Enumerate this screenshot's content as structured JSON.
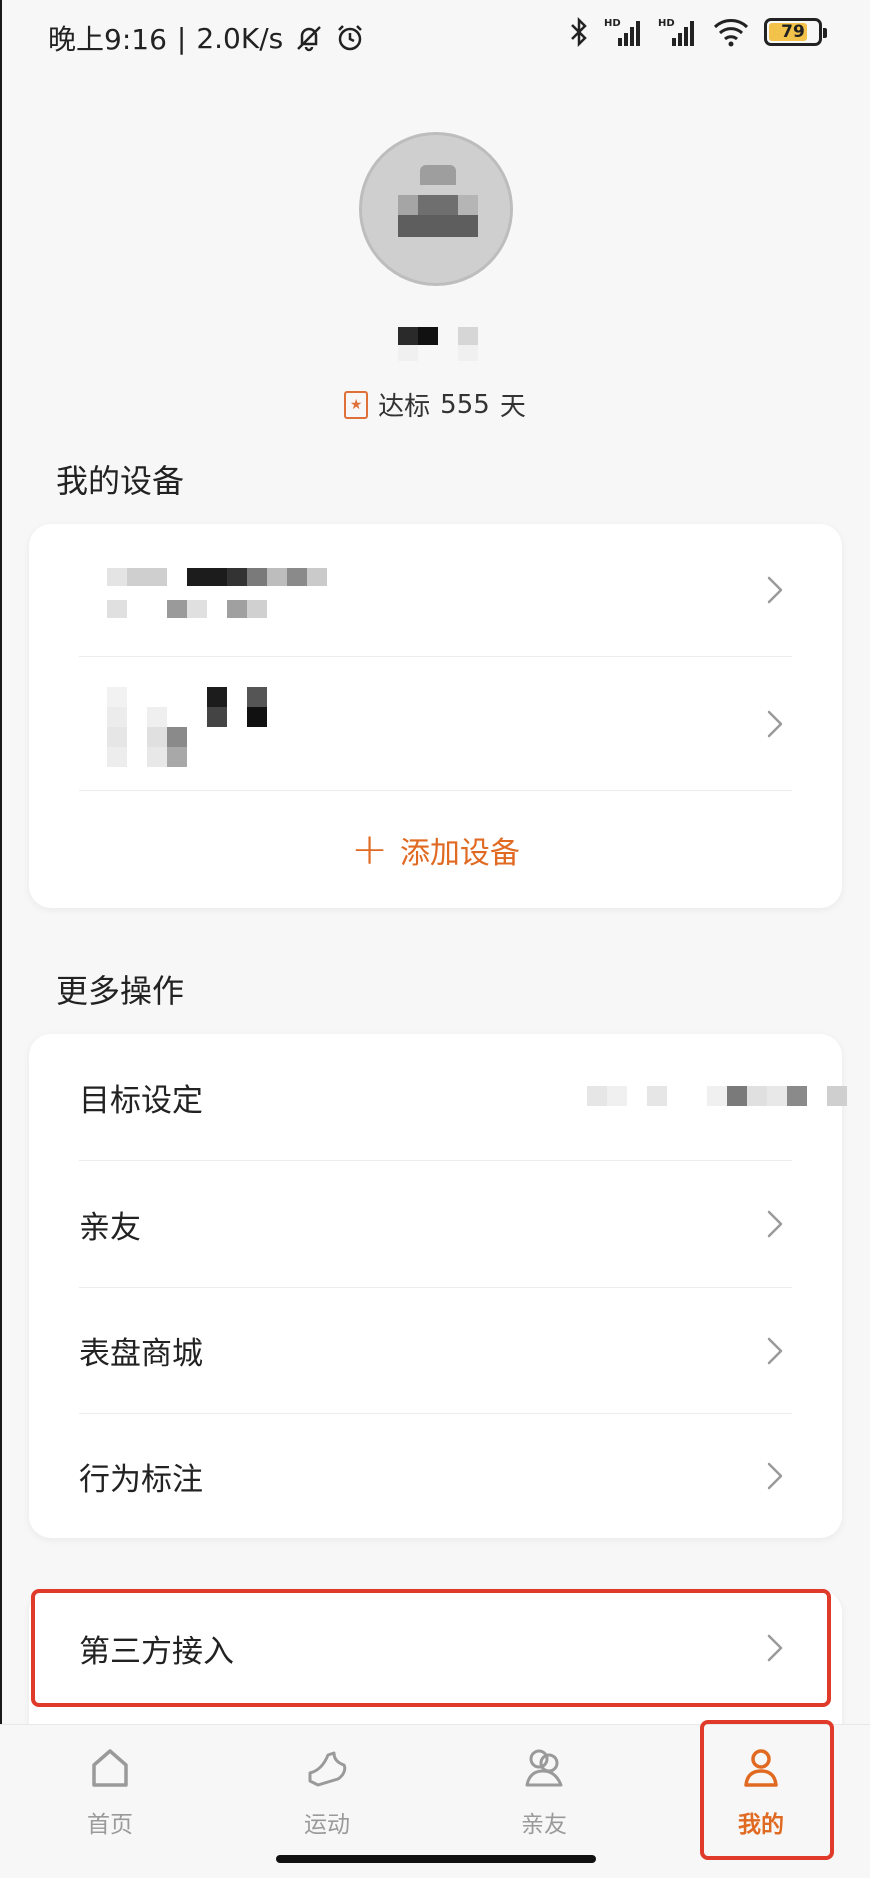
{
  "status_bar": {
    "time": "晚上9:16",
    "separator": "|",
    "net_speed": "2.0K/s",
    "battery_level": "79",
    "battery_fraction": 0.79,
    "signal_label_1": "HD",
    "signal_label_2": "HD"
  },
  "profile": {
    "streak_label": "达标",
    "streak_days": "555",
    "streak_unit": "天"
  },
  "devices_section": {
    "title": "我的设备",
    "add_device_label": "添加设备"
  },
  "more_section": {
    "title": "更多操作",
    "items": [
      {
        "label": "目标设定"
      },
      {
        "label": "亲友"
      },
      {
        "label": "表盘商城"
      },
      {
        "label": "行为标注"
      }
    ]
  },
  "third_party": {
    "label": "第三方接入"
  },
  "bottom_nav": {
    "items": [
      {
        "label": "首页",
        "icon": "home-icon",
        "active": false
      },
      {
        "label": "运动",
        "icon": "shoe-icon",
        "active": false
      },
      {
        "label": "亲友",
        "icon": "friends-icon",
        "active": false
      },
      {
        "label": "我的",
        "icon": "person-icon",
        "active": true
      }
    ]
  },
  "colors": {
    "accent": "#e06a22",
    "highlight": "#e03a2a",
    "battery": "#f2c24b"
  }
}
